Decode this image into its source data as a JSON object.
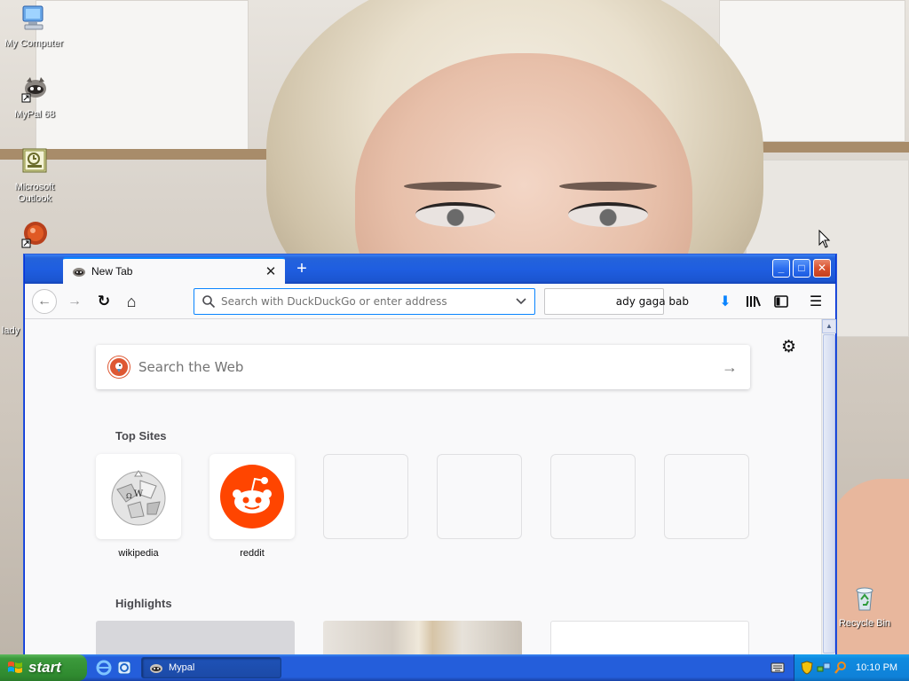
{
  "desktop": {
    "icons": [
      {
        "label": "My Computer",
        "icon": "my-computer-icon"
      },
      {
        "label": "MyPal 68",
        "icon": "mypal-icon"
      },
      {
        "label": "Microsoft Outlook",
        "icon": "outlook-icon"
      },
      {
        "label": "lady",
        "icon": "app-icon"
      },
      {
        "label": "Recycle Bin",
        "icon": "recycle-bin-icon"
      }
    ]
  },
  "browser": {
    "tab": {
      "title": "New Tab",
      "favicon": "raccoon-icon"
    },
    "new_tab_symbol": "+",
    "window_buttons": {
      "minimize": "_",
      "maximize": "□",
      "close": "✕"
    },
    "nav": {
      "back": "←",
      "forward": "→",
      "reload": "↻",
      "home": "⌂"
    },
    "urlbar": {
      "placeholder": "Search with DuckDuckGo or enter address",
      "value": ""
    },
    "searchbar": {
      "value": "ady gaga bab"
    },
    "toolbar": {
      "downloads": "⬇",
      "library": "library-icon",
      "sidebar": "sidebar-icon",
      "menu": "☰"
    },
    "accent_color": "#0a84ff"
  },
  "newtab": {
    "settings_icon": "⚙",
    "search": {
      "placeholder": "Search the Web",
      "engine_icon": "duckduckgo-icon",
      "go": "→"
    },
    "top_sites_title": "Top Sites",
    "top_sites": [
      {
        "label": "wikipedia",
        "icon": "wikipedia-icon"
      },
      {
        "label": "reddit",
        "icon": "reddit-icon"
      },
      {
        "label": ""
      },
      {
        "label": ""
      },
      {
        "label": ""
      },
      {
        "label": ""
      }
    ],
    "highlights_title": "Highlights"
  },
  "taskbar": {
    "start_label": "start",
    "task": {
      "label": "Mypal",
      "icon": "raccoon-icon"
    },
    "clock": "10:10 PM"
  }
}
